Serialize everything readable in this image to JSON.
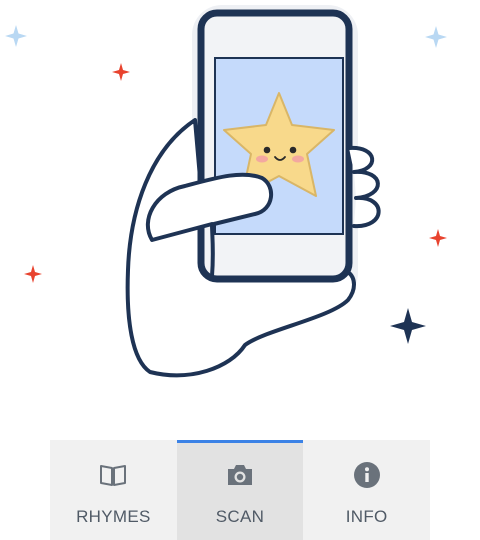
{
  "colors": {
    "accent": "#3b82e6",
    "outline": "#1e3354",
    "screen": "#c5dafb",
    "star_fill": "#f8d98b",
    "sparkle_red": "#e8432e",
    "sparkle_blue": "#b9d8f3",
    "icon_gray": "#6a727b"
  },
  "illustration": {
    "subject": "hand-holding-phone-with-star",
    "sparkle-icons": [
      "sparkle-blue-icon",
      "sparkle-red-icon",
      "sparkle-dark-icon"
    ]
  },
  "bottom_nav": {
    "items": [
      {
        "label": "RHYMES",
        "icon": "book-icon",
        "active": false
      },
      {
        "label": "SCAN",
        "icon": "camera-icon",
        "active": true
      },
      {
        "label": "INFO",
        "icon": "info-icon",
        "active": false
      }
    ]
  }
}
